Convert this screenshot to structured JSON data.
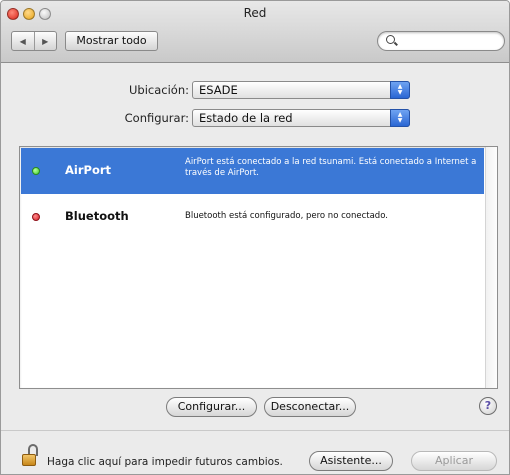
{
  "window": {
    "title": "Red"
  },
  "toolbar": {
    "back_glyph": "◀",
    "forward_glyph": "▶",
    "show_all_label": "Mostrar todo",
    "search_value": "",
    "search_placeholder": ""
  },
  "location": {
    "label": "Ubicación:",
    "value": "ESADE"
  },
  "configure_popup": {
    "label": "Configurar:",
    "value": "Estado de la red"
  },
  "services": [
    {
      "name": "AirPort",
      "status_color": "#3fcf2f",
      "description": "AirPort está conectado a la red tsunami. Está conectado a Internet a través de AirPort.",
      "selected": true
    },
    {
      "name": "Bluetooth",
      "status_color": "#d6202a",
      "description": "Bluetooth está configurado, pero no conectado.",
      "selected": false
    }
  ],
  "actions": {
    "configure_label": "Configurar...",
    "disconnect_label": "Desconectar...",
    "help_glyph": "?"
  },
  "footer": {
    "lock_text": "Haga clic aquí para impedir futuros cambios.",
    "assistant_label": "Asistente...",
    "apply_label": "Aplicar"
  },
  "colors": {
    "selection": "#3b78d6",
    "popup_arrow": "#2a66d3"
  }
}
